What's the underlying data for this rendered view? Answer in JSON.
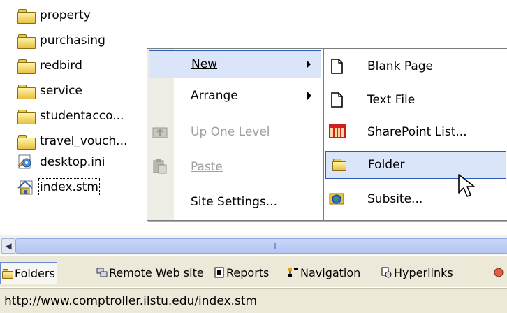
{
  "files": [
    {
      "name": "property",
      "icon": "folder-icon"
    },
    {
      "name": "purchasing",
      "icon": "folder-icon"
    },
    {
      "name": "redbird",
      "icon": "folder-icon"
    },
    {
      "name": "service",
      "icon": "folder-icon"
    },
    {
      "name": "studentacco...",
      "icon": "folder-icon"
    },
    {
      "name": "travel_vouch...",
      "icon": "folder-icon"
    },
    {
      "name": "desktop.ini",
      "icon": "settings-file-icon"
    },
    {
      "name": "index.stm",
      "icon": "home-page-icon"
    }
  ],
  "context_menu": {
    "items": [
      {
        "label": "New",
        "has_submenu": true,
        "highlighted": true
      },
      {
        "label": "Arrange",
        "has_submenu": true
      },
      {
        "label": "Up One Level",
        "disabled": true,
        "icon": "up-folder-icon"
      },
      {
        "label": "Paste",
        "disabled": true,
        "icon": "paste-icon"
      },
      {
        "label": "Site Settings..."
      }
    ]
  },
  "submenu": {
    "items": [
      {
        "label": "Blank Page",
        "icon": "page-icon"
      },
      {
        "label": "Text File",
        "icon": "page-icon"
      },
      {
        "label": "SharePoint List...",
        "icon": "list-icon"
      },
      {
        "label": "Folder",
        "icon": "folder-icon",
        "highlighted": true
      },
      {
        "label": "Subsite...",
        "icon": "web-icon"
      }
    ]
  },
  "view_tabs": [
    {
      "label": "Folders",
      "active": true
    },
    {
      "label": "Remote Web site"
    },
    {
      "label": "Reports"
    },
    {
      "label": "Navigation"
    },
    {
      "label": "Hyperlinks"
    }
  ],
  "status": {
    "text": "http://www.comptroller.ilstu.edu/index.stm"
  },
  "colors": {
    "highlight": "#dbe5f9",
    "highlight_border": "#2f5fb3",
    "toolbar": "#ece9d8"
  }
}
